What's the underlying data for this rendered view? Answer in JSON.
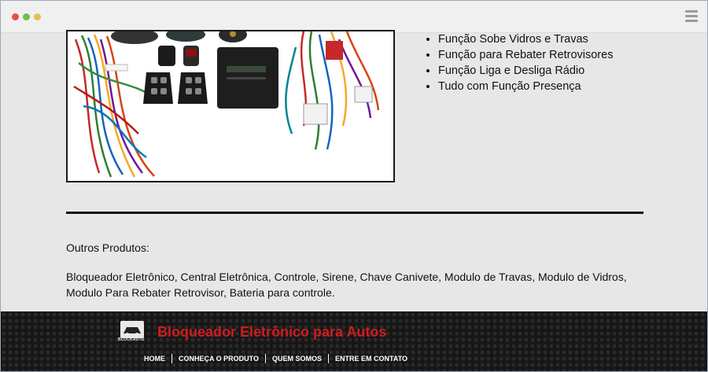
{
  "browser": {
    "dots": [
      "red",
      "green",
      "yellow"
    ],
    "menu_icon": "hamburger-icon"
  },
  "product": {
    "image_alt": "Kit bloqueador eletrônico com chicotes, controles e central",
    "features": [
      "Função Sobe Vidros e Travas",
      "Função para Rebater Retrovisores",
      "Função Liga e Desliga Rádio",
      "Tudo com Função Presença"
    ]
  },
  "other_products": {
    "title": "Outros Produtos:",
    "text": "Bloqueador Eletrônico, Central Eletrônica, Controle, Sirene, Chave Canivete, Modulo de Travas, Modulo de Vidros, Modulo Para Rebater Retrovisor, Bateria para controle."
  },
  "footer": {
    "logo_text": "BLOCKAUTO",
    "site_title": "Bloqueador Eletrônico para Autos",
    "nav": [
      {
        "label": "HOME"
      },
      {
        "label": "CONHEÇA O PRODUTO"
      },
      {
        "label": "QUEM SOMOS"
      },
      {
        "label": "ENTRE EM CONTATO"
      }
    ]
  },
  "colors": {
    "page_bg": "#e7e7e7",
    "footer_bg": "#161616",
    "title_red": "#d01c1c"
  }
}
